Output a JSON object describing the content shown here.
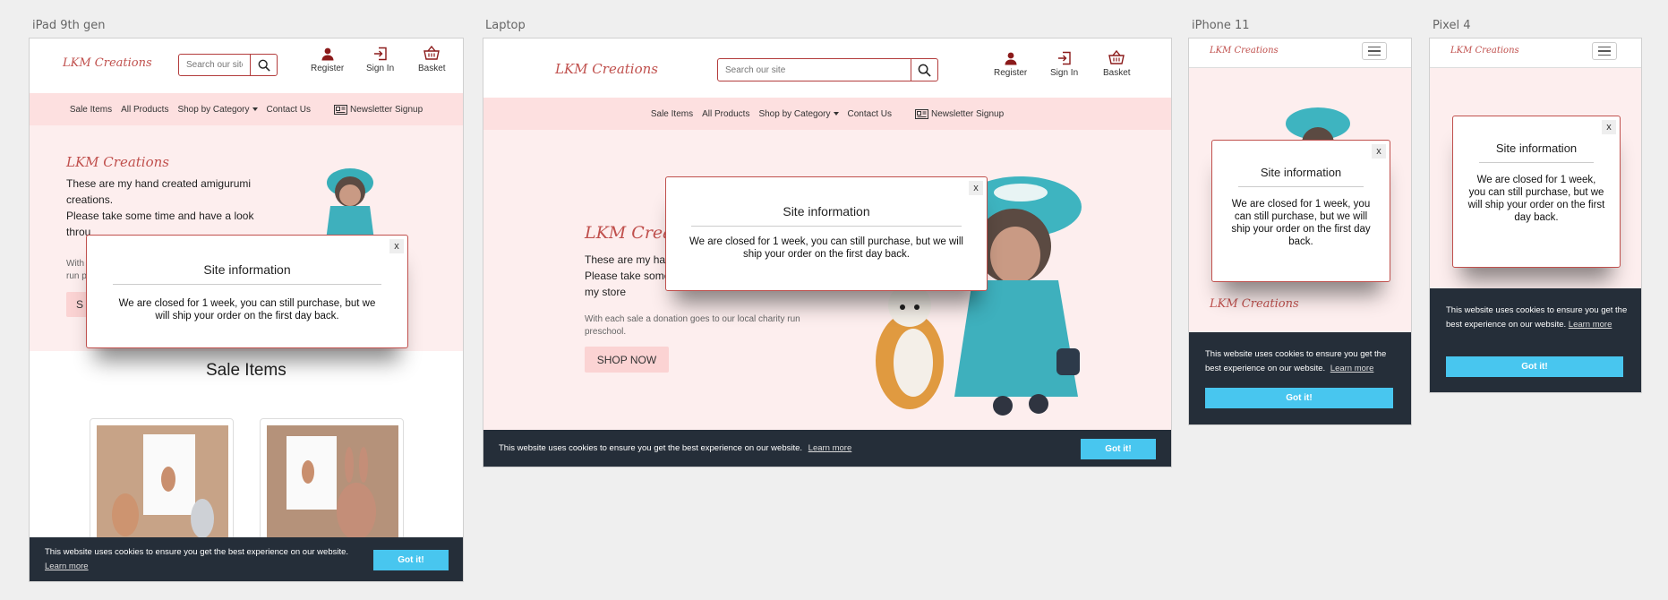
{
  "labels": {
    "ipad": "iPad 9th gen",
    "laptop": "Laptop",
    "iphone": "iPhone 11",
    "pixel": "Pixel 4"
  },
  "site": {
    "logo": "LKM Creations",
    "search_placeholder": "Search our site",
    "header_links": {
      "register": "Register",
      "signin": "Sign In",
      "basket": "Basket"
    },
    "nav": {
      "sale": "Sale Items",
      "all": "All Products",
      "category": "Shop by Category",
      "contact": "Contact Us",
      "newsletter": "Newsletter Signup"
    },
    "hero": {
      "title": "LKM Creations",
      "line1": "These are my hand created amigurumi creations.",
      "line2": "Please take some time and have a look through my store",
      "laptop_line1": "These are my hand",
      "laptop_line2": "Please take some",
      "laptop_line3": "my store",
      "ipad_line1": "These are my hand created amigurumi",
      "ipad_line2": "creations.",
      "ipad_line3": "Please take some time and have a look",
      "ipad_line4": "throu",
      "charity": "With each sale a donation goes to our local charity run preschool.",
      "charity_l1": "With each sale a donation goes to our local charity run",
      "charity_l2": "preschool.",
      "ipad_charity_l1": "With",
      "ipad_charity_l2": "run p",
      "shop_now": "SHOP NOW",
      "ipad_shop": "S"
    },
    "modal": {
      "close": "x",
      "title": "Site information",
      "body": "We are closed for 1 week, you can still purchase, but we will ship your order on the first day back."
    },
    "sale_items_title": "Sale Items",
    "cookie": {
      "text": "This website uses cookies to ensure you get the best experience on our website.",
      "learn_more": "Learn more",
      "got_it": "Got it!"
    }
  },
  "colors": {
    "accent": "#c0504d",
    "nav_bg": "#fde0e0",
    "hero_bg": "#fdeeee",
    "cookie_bg": "#252e39",
    "cookie_btn": "#48c6ef"
  }
}
